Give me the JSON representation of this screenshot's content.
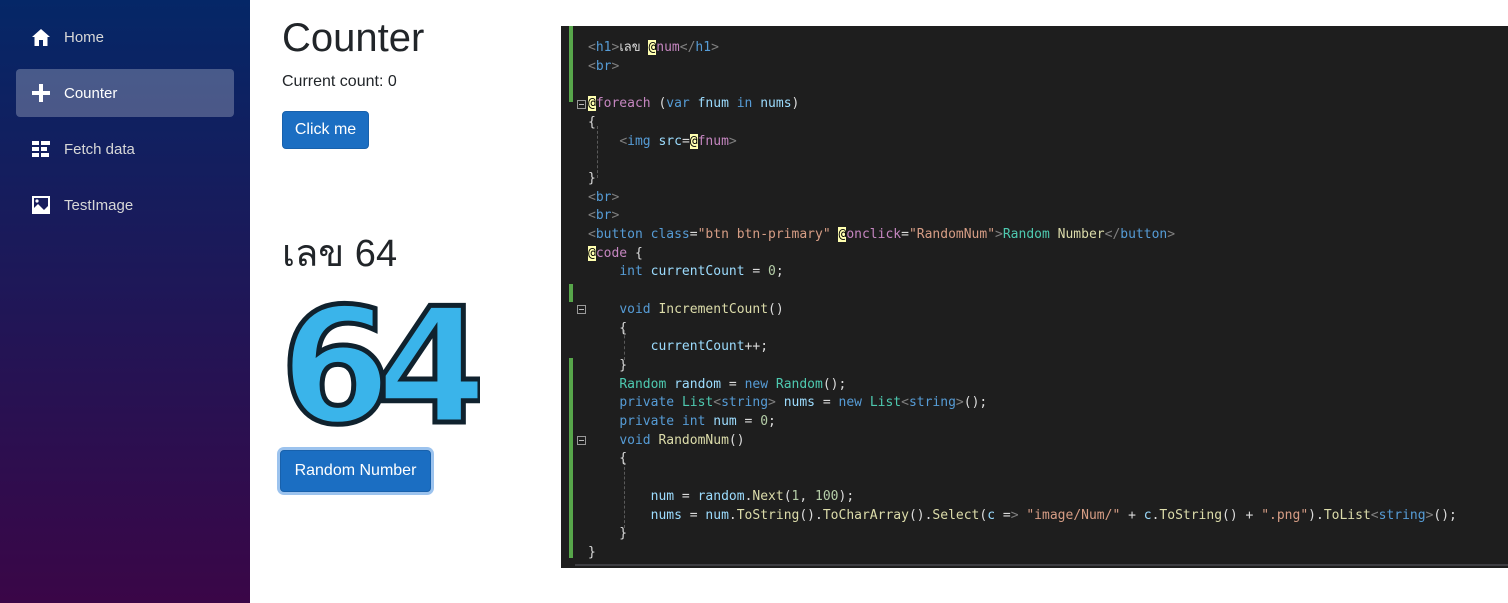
{
  "sidebar": {
    "items": [
      {
        "label": "Home",
        "icon": "home-icon",
        "active": false
      },
      {
        "label": "Counter",
        "icon": "plus-icon",
        "active": true
      },
      {
        "label": "Fetch data",
        "icon": "list-icon",
        "active": false
      },
      {
        "label": "TestImage",
        "icon": "image-icon",
        "active": false
      }
    ]
  },
  "main": {
    "title": "Counter",
    "current_count": "Current count: 0",
    "click_button": "Click me",
    "num_heading": "เลข 64",
    "digits": [
      "6",
      "4"
    ],
    "random_button": "Random Number"
  },
  "code": {
    "lines": [
      "<h1>เลข @num</h1>",
      "<br>",
      "",
      "@foreach (var fnum in nums)",
      "{",
      "    <img src=@fnum>",
      "",
      "}",
      "<br>",
      "<br>",
      "<button class=\"btn btn-primary\" @onclick=\"RandomNum\">Random Number</button>",
      "@code {",
      "    int currentCount = 0;",
      "",
      "    void IncrementCount()",
      "    {",
      "        currentCount++;",
      "    }",
      "    Random random = new Random();",
      "    private List<string> nums = new List<string>();",
      "    private int num = 0;",
      "    void RandomNum()",
      "    {",
      "",
      "        num = random.Next(1, 100);",
      "        nums = num.ToString().ToCharArray().Select(c => \"image/Num/\" + c.ToString() + \".png\").ToList<string>();",
      "    }",
      "}"
    ]
  },
  "colors": {
    "sidebar_top": "#052767",
    "sidebar_bottom": "#3a0647",
    "button": "#1b6ec2",
    "digit_fill": "#3ab4ea",
    "digit_outline": "#10222e",
    "code_bg": "#1e1e1e"
  }
}
